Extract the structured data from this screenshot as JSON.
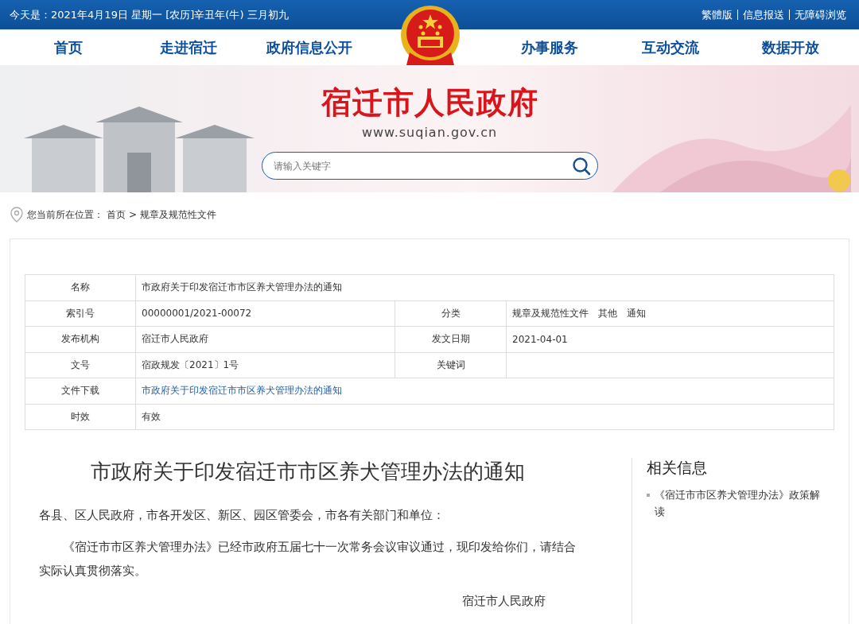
{
  "top_bar": {
    "date": "今天是：2021年4月19日 星期一 [农历]辛丑年(牛) 三月初九",
    "links": [
      "繁體版",
      "信息报送",
      "无障碍浏览"
    ]
  },
  "nav": {
    "left": [
      "首页",
      "走进宿迁",
      "政府信息公开"
    ],
    "right": [
      "办事服务",
      "互动交流",
      "数据开放"
    ]
  },
  "banner": {
    "title": "宿迁市人民政府",
    "url": "www.suqian.gov.cn"
  },
  "search": {
    "placeholder": "请输入关键字"
  },
  "breadcrumb": {
    "prefix": "您当前所在位置：",
    "items": [
      "首页",
      "规章及规范性文件"
    ],
    "separator": ">"
  },
  "table": {
    "rows": [
      [
        {
          "label": "名称",
          "value": "市政府关于印发宿迁市市区养犬管理办法的通知"
        }
      ],
      [
        {
          "label": "索引号",
          "value": "00000001/2021-00072"
        },
        {
          "label": "分类",
          "value": "规章及规范性文件　其他　通知"
        }
      ],
      [
        {
          "label": "发布机构",
          "value": "宿迁市人民政府"
        },
        {
          "label": "发文日期",
          "value": "2021-04-01"
        }
      ],
      [
        {
          "label": "文号",
          "value": "宿政规发〔2021〕1号"
        },
        {
          "label": "关键词"
        }
      ],
      [
        {
          "label": "文件下载",
          "link_text": "市政府关于印发宿迁市市区养犬管理办法的通知"
        }
      ],
      [
        {
          "label": "时效",
          "value": "有效"
        }
      ]
    ]
  },
  "article": {
    "title": "市政府关于印发宿迁市市区养犬管理办法的通知",
    "salutation": "各县、区人民政府，市各开发区、新区、园区管委会，市各有关部门和单位：",
    "paragraphs": [
      "《宿迁市市区养犬管理办法》已经市政府五届七十一次常务会议审议通过，现印发给你们，请结合实际认真贯彻落实。"
    ],
    "signature": "宿迁市人民政府"
  },
  "sidebar": {
    "title": "相关信息",
    "items": [
      "《宿迁市市区养犬管理办法》政策解读"
    ]
  }
}
